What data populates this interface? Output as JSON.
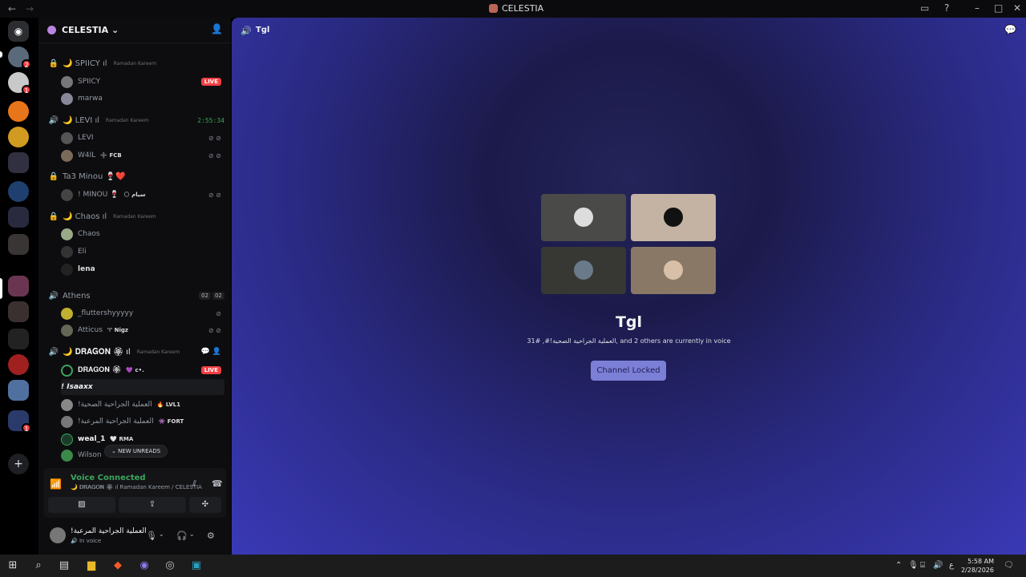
{
  "titlebar": {
    "title": "CELESTIA"
  },
  "server": {
    "name": "CELESTIA"
  },
  "channels": [
    {
      "name": "🌙 SPIICY ıl",
      "sub": "Ramadan Kareem",
      "icon": "lock-icon"
    },
    {
      "name": "🌙 LEVI ıl",
      "sub": "Ramadan Kareem",
      "icon": "speaker-icon",
      "timer": "2:55:34"
    },
    {
      "name": "Ta3 Minou 🍷❤️",
      "sub": "",
      "icon": "lock-icon"
    },
    {
      "name": "🌙 Chaos ıl",
      "sub": "Ramadan Kareem",
      "icon": "lock-icon"
    },
    {
      "name": "Athens",
      "sub": "",
      "icon": "speaker-icon",
      "count_a": "02",
      "count_b": "02"
    },
    {
      "name": "🌙 𝐃𝐑𝐀𝐆𝐎𝐍 🏵 ıl",
      "sub": "Ramadan Kareem",
      "icon": "speaker-icon"
    }
  ],
  "users": [
    {
      "name": "SPIICY",
      "tag": "",
      "live": "LIVE"
    },
    {
      "name": "marwa",
      "tag": ""
    },
    {
      "name": "LEVI",
      "tag": ""
    },
    {
      "name": "W4IL",
      "tag": "➕ FCB"
    },
    {
      "name": "! MINOU 🍷",
      "tag": "🌕 سيام"
    },
    {
      "name": "Chaos",
      "tag": ""
    },
    {
      "name": "Eli",
      "tag": ""
    },
    {
      "name": "lena",
      "tag": ""
    },
    {
      "name": "_fluttershyyyyy",
      "tag": ""
    },
    {
      "name": "Atticus",
      "tag": "♈ Nigz"
    },
    {
      "name": "𝐃𝐑𝐀𝐆𝐎𝐍 🏵",
      "tag": "💜 c•.",
      "live": "LIVE"
    },
    {
      "name": "! Isaaxx",
      "tag": ""
    },
    {
      "name": "!العملية الجراحية الصحية",
      "tag": "🔥 LVL1"
    },
    {
      "name": "!العملية الجراحية المرعبة",
      "tag": "👾 FORT"
    },
    {
      "name": "weal_1",
      "tag": "🤍 RMA"
    },
    {
      "name": "Wilson",
      "tag": ""
    }
  ],
  "new_unreads": "NEW UNREADS",
  "voice": {
    "title": "Voice Connected",
    "sub": "🌙 𝐃𝐑𝐀𝐆𝐎𝐍 🏵 ıl  Ramadan Kareem / CELESTIA"
  },
  "me": {
    "name": "!العملية الجراحية المرعبة",
    "status": "In voice"
  },
  "main": {
    "channel": "Tgl",
    "title": "Tgl",
    "subtitle": "العملية الجراحية الصحية!#, #31, and 2 others are currently in voice",
    "button": "Channel Locked"
  },
  "taskbar": {
    "time": "5:58 AM",
    "date": "2/28/2026"
  }
}
